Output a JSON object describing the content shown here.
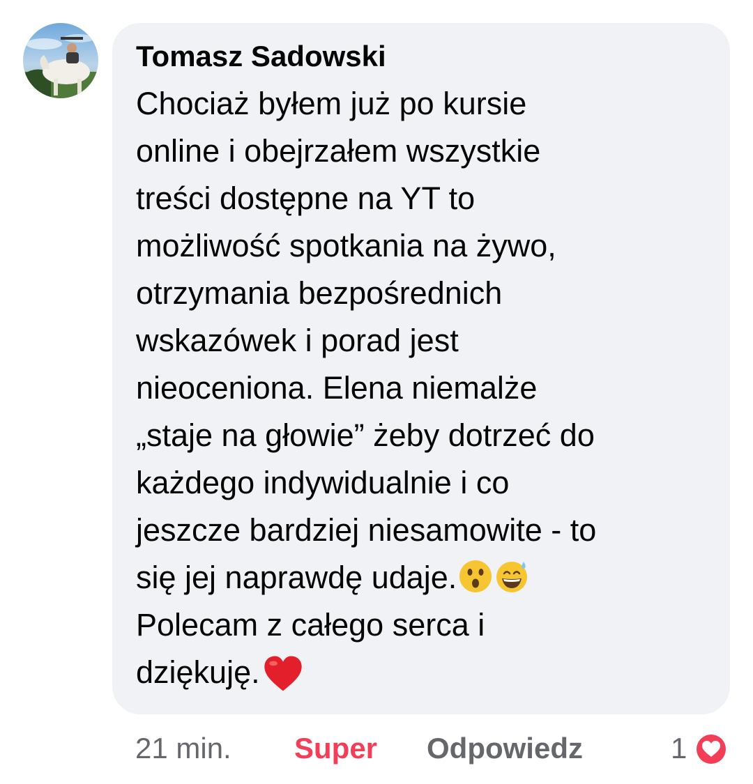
{
  "comment": {
    "author": "Tomasz Sadowski",
    "lines": [
      "Chociaż byłem już po kursie",
      "online i obejrzałem wszystkie",
      "treści dostępne na YT to",
      "możliwość spotkania na żywo,",
      "otrzymania bezpośrednich",
      "wskazówek i porad jest",
      "nieoceniona. Elena niemalże",
      "„staje na głowie” żeby dotrzeć do",
      "każdego indywidualnie i co",
      "jeszcze bardziej niesamowite - to",
      "się jej naprawdę udaje.",
      "Polecam z całego serca i",
      "dziękuję."
    ],
    "inline_emojis": [
      "astonished-face-emoji",
      "grinning-sweat-face-emoji",
      "red-heart-emoji"
    ]
  },
  "meta": {
    "time": "21 min.",
    "like_label": "Super",
    "reply_label": "Odpowiedz",
    "reaction_count": "1",
    "reaction_icon": "love-reaction-icon"
  },
  "colors": {
    "bubble_bg": "#f0f2f5",
    "text": "#050505",
    "secondary": "#65676b",
    "love": "#f33e58"
  }
}
